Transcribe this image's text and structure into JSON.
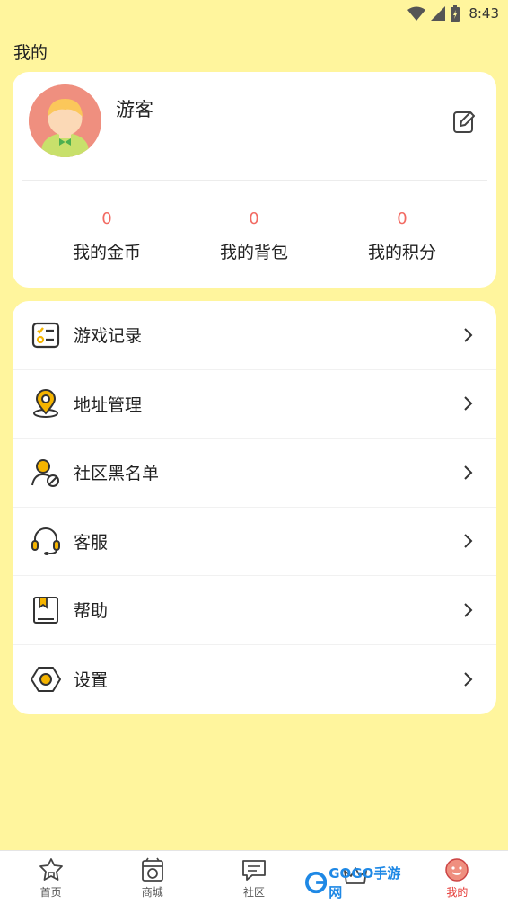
{
  "status_bar": {
    "time": "8:43"
  },
  "page_title": "我的",
  "profile": {
    "name": "游客",
    "stats": [
      {
        "value": "0",
        "label": "我的金币"
      },
      {
        "value": "0",
        "label": "我的背包"
      },
      {
        "value": "0",
        "label": "我的积分"
      }
    ]
  },
  "menu": [
    {
      "label": "游戏记录",
      "icon": "game-record-icon"
    },
    {
      "label": "地址管理",
      "icon": "location-pin-icon"
    },
    {
      "label": "社区黑名单",
      "icon": "user-block-icon"
    },
    {
      "label": "客服",
      "icon": "headset-icon"
    },
    {
      "label": "帮助",
      "icon": "help-book-icon"
    },
    {
      "label": "设置",
      "icon": "settings-hexagon-icon"
    }
  ],
  "nav": [
    {
      "label": "首页",
      "icon": "home-icon"
    },
    {
      "label": "商城",
      "icon": "shop-icon"
    },
    {
      "label": "社区",
      "icon": "chat-icon"
    },
    {
      "label": "",
      "icon": "crown-icon"
    },
    {
      "label": "我的",
      "icon": "profile-face-icon",
      "active": true
    }
  ],
  "watermark": {
    "text": "GOGO手游网"
  },
  "colors": {
    "background": "#fff59d",
    "accent": "#f5b400",
    "stat_value": "#f26a62",
    "active_nav": "#e53935"
  }
}
